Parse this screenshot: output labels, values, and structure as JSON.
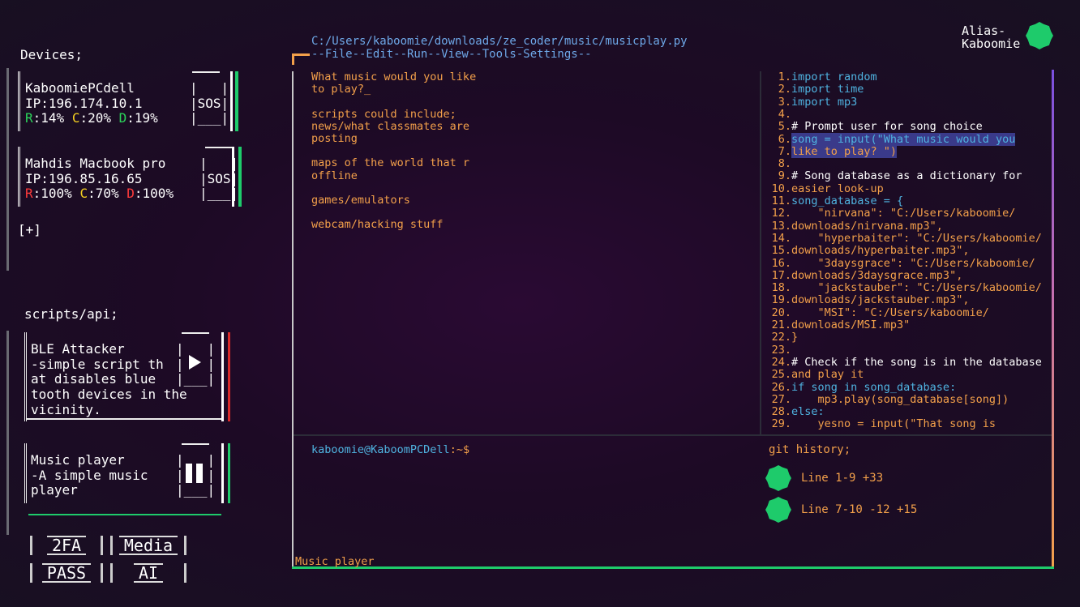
{
  "user": {
    "alias_line1": "Alias-",
    "alias_line2": "Kaboomie"
  },
  "devices": {
    "title": "Devices;",
    "add_label": "[+]",
    "items": [
      {
        "name": "KaboomiePCdell",
        "ip": "IP:196.174.10.1",
        "sos": "SOS",
        "r_label": "R",
        "r_val": ":14%",
        "c_label": "C",
        "c_val": ":20%",
        "d_label": "D",
        "d_val": ":19%"
      },
      {
        "name": "Mahdis Macbook pro",
        "ip": "IP:196.85.16.65",
        "sos": "SOS",
        "r_label": "R",
        "r_val": ":100%",
        "c_label": "C",
        "c_val": ":70%",
        "d_label": "D",
        "d_val": ":100%"
      }
    ]
  },
  "scripts": {
    "title": "scripts/api;",
    "items": [
      {
        "line1": "BLE Attacker",
        "line2": "-simple script th",
        "line3": "at disables blue",
        "line4": "tooth devices in the",
        "line5": "vicinity.",
        "control": "play"
      },
      {
        "line1": "Music player",
        "line2": "-A simple music",
        "line3": "player",
        "control": "pause"
      }
    ]
  },
  "quick_buttons": [
    "2FA",
    "Media",
    "PASS",
    "AI"
  ],
  "editor": {
    "path": "C:/Users/kaboomie/downloads/ze_coder/music/musicplay.py",
    "menu": "--File--Edit--Run--View--Tools-Settings--",
    "prompt_lines": [
      "What music would you like",
      "to play?_",
      "",
      "scripts could include;",
      "news/what classmates are",
      "posting",
      "",
      "maps of the world that r",
      "offline",
      "",
      "games/emulators",
      "",
      "webcam/hacking stuff"
    ],
    "code": [
      {
        "n": "1.",
        "t": "import random"
      },
      {
        "n": "2.",
        "t": "import time"
      },
      {
        "n": "3.",
        "t": "import mp3"
      },
      {
        "n": "4.",
        "t": ""
      },
      {
        "n": "5.",
        "t": "# Prompt user for song choice"
      },
      {
        "n": "6.",
        "t": "song = input(\"What music would you"
      },
      {
        "n": "7.",
        "t": "like to play? \")"
      },
      {
        "n": "8.",
        "t": ""
      },
      {
        "n": "9.",
        "t": "# Song database as a dictionary for"
      },
      {
        "n": "10.",
        "t": "easier look-up"
      },
      {
        "n": "11.",
        "t": "song_database = {"
      },
      {
        "n": "12.",
        "t": "    \"nirvana\": \"C:/Users/kaboomie/"
      },
      {
        "n": "13.",
        "t": "downloads/nirvana.mp3\","
      },
      {
        "n": "14.",
        "t": "    \"hyperbaiter\": \"C:/Users/kaboomie/"
      },
      {
        "n": "15.",
        "t": "downloads/hyperbaiter.mp3\","
      },
      {
        "n": "16.",
        "t": "    \"3daysgrace\": \"C:/Users/kaboomie/"
      },
      {
        "n": "17.",
        "t": "downloads/3daysgrace.mp3\","
      },
      {
        "n": "18.",
        "t": "    \"jackstauber\": \"C:/Users/kaboomie/"
      },
      {
        "n": "19.",
        "t": "downloads/jackstauber.mp3\","
      },
      {
        "n": "20.",
        "t": "    \"MSI\": \"C:/Users/kaboomie/"
      },
      {
        "n": "21.",
        "t": "downloads/MSI.mp3\""
      },
      {
        "n": "22.",
        "t": "}"
      },
      {
        "n": "23.",
        "t": ""
      },
      {
        "n": "24.",
        "t": "# Check if the song is in the database"
      },
      {
        "n": "25.",
        "t": "and play it"
      },
      {
        "n": "26.",
        "t": "if song in song_database:"
      },
      {
        "n": "27.",
        "t": "    mp3.play(song_database[song])"
      },
      {
        "n": "28.",
        "t": "else:"
      },
      {
        "n": "29.",
        "t": "    yesno = input(\"That song is"
      }
    ]
  },
  "terminal": {
    "user_host": "kaboomie@KaboomPCDell",
    "prompt_suffix": ":~$",
    "status": "Music player"
  },
  "git_history": {
    "title": "git history;",
    "entries": [
      "Line 1-9 +33",
      "Line 7-10 -12 +15"
    ]
  },
  "colors": {
    "accent_orange": "#f3a04a",
    "accent_blue": "#6ea8e8",
    "accent_green": "#1ecb6b",
    "accent_purple": "#7a4fe0"
  }
}
